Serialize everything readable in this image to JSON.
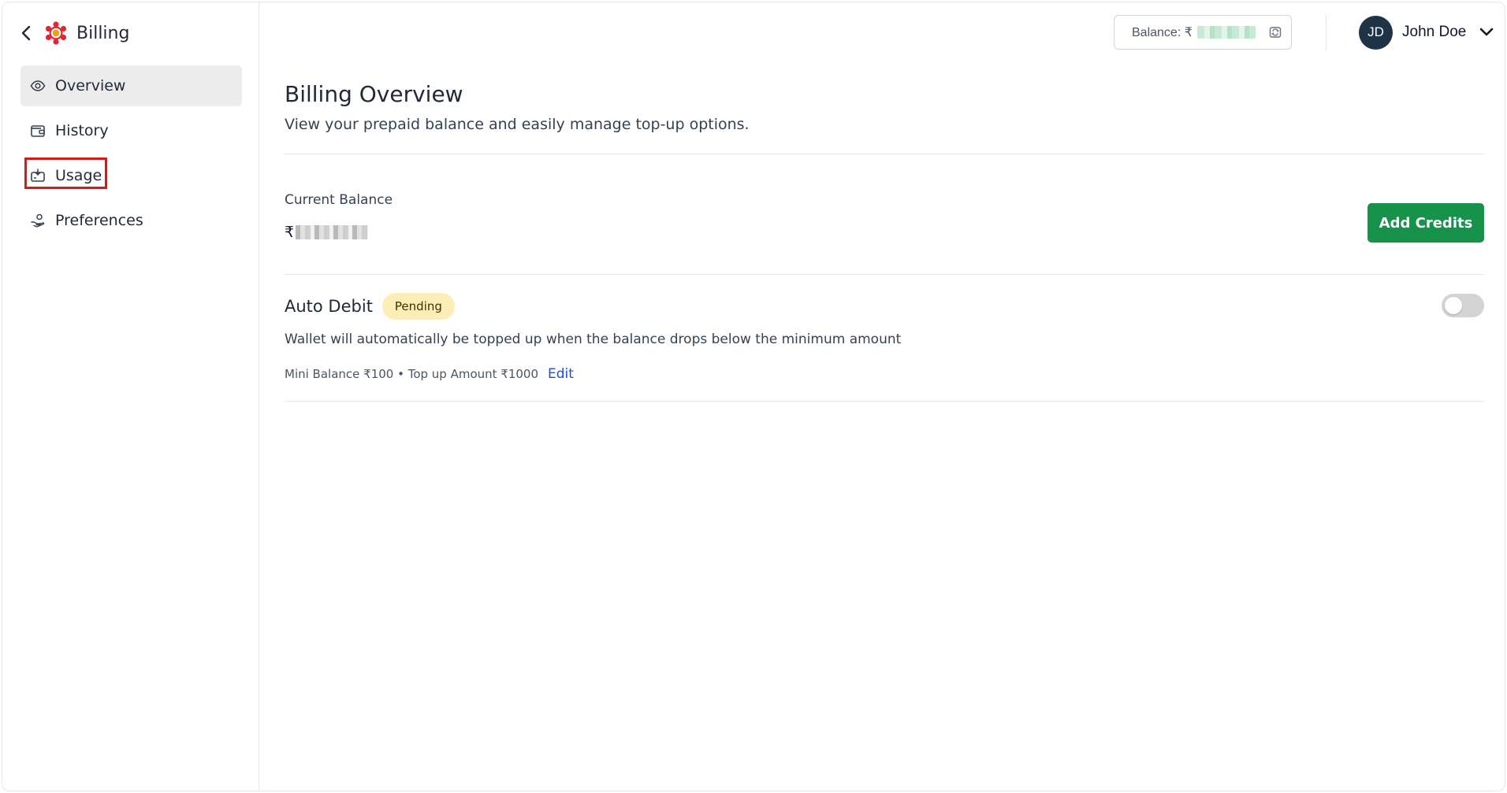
{
  "sidebar": {
    "title": "Billing",
    "items": [
      {
        "label": "Overview"
      },
      {
        "label": "History"
      },
      {
        "label": "Usage"
      },
      {
        "label": "Preferences"
      }
    ]
  },
  "header": {
    "balance_label": "Balance: ₹",
    "user_initials": "JD",
    "user_name": "John Doe"
  },
  "main": {
    "title": "Billing Overview",
    "subtitle": "View your prepaid balance and easily manage top-up options.",
    "current_balance_label": "Current Balance",
    "currency_symbol": "₹",
    "add_credits_label": "Add Credits",
    "auto_debit": {
      "title": "Auto Debit",
      "status": "Pending",
      "description": "Wallet will automatically be topped up when the balance drops below the minimum amount",
      "meta": "Mini Balance ₹100 • Top up Amount ₹1000",
      "edit_label": "Edit"
    }
  },
  "colors": {
    "accent_green": "#16924a",
    "badge_bg": "#fdeeb6",
    "link_blue": "#1d4ed8",
    "avatar_bg": "#1f3347",
    "highlight_red": "#e01515"
  }
}
